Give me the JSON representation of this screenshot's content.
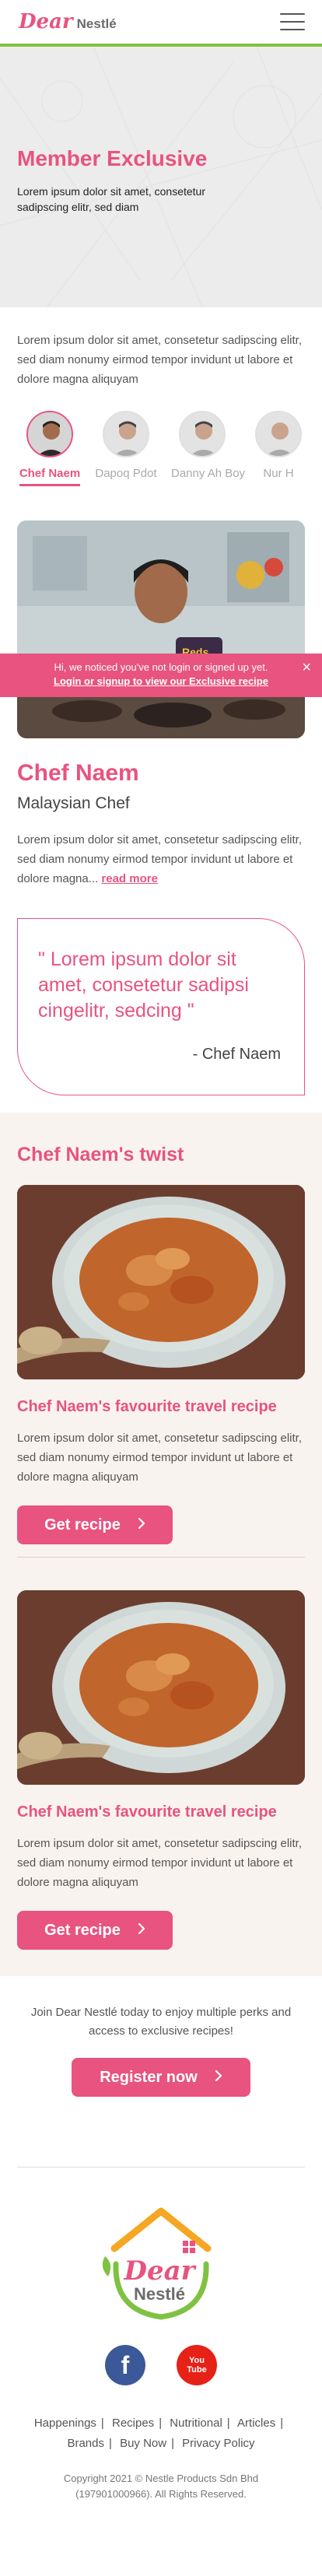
{
  "header": {
    "logo_dear": "Dear",
    "logo_nestle": "Nestlé",
    "menu_icon": "hamburger-menu-icon"
  },
  "hero": {
    "title": "Member Exclusive",
    "subtitle": "Lorem ipsum dolor sit amet, consetetur sadipscing elitr, sed diam"
  },
  "intro": "Lorem ipsum dolor sit amet, consetetur sadipscing elitr, sed diam nonumy eirmod tempor invidunt ut labore et dolore magna aliquyam",
  "chefs": [
    {
      "name": "Chef Naem",
      "active": true
    },
    {
      "name": "Dapoq Pdot",
      "active": false
    },
    {
      "name": "Danny Ah Boy",
      "active": false
    },
    {
      "name": "Nur H",
      "active": false
    }
  ],
  "login_banner": {
    "message": "Hi, we noticed you've not login or signed up yet.",
    "link": "Login or signup to view our Exclusive recipe",
    "close": "×"
  },
  "chef_profile": {
    "name": "Chef Naem",
    "origin": "Malaysian Chef",
    "bio": "Lorem ipsum dolor sit amet, consetetur sadipscing elitr, sed diam nonumy eirmod tempor invidunt ut labore et dolore magna...",
    "read_more": "read more",
    "quote": "\" Lorem ipsum dolor sit amet, consetetur sadipsi cingelitr, sedcing \"",
    "quote_author": "- Chef Naem"
  },
  "twist": {
    "title": "Chef Naem's twist",
    "recipes": [
      {
        "title": "Chef Naem's favourite travel recipe",
        "desc": "Lorem ipsum dolor sit amet, consetetur sadipscing elitr, sed diam nonumy eirmod tempor invidunt ut labore et dolore magna aliquyam",
        "button": "Get recipe"
      },
      {
        "title": "Chef Naem's favourite travel recipe",
        "desc": "Lorem ipsum dolor sit amet, consetetur sadipscing elitr, sed diam nonumy eirmod tempor invidunt ut labore et dolore magna aliquyam",
        "button": "Get recipe"
      }
    ]
  },
  "join": {
    "text": "Join Dear Nestlé today to enjoy multiple perks and access to exclusive recipes!",
    "button": "Register now"
  },
  "footer": {
    "logo_dear": "Dear",
    "logo_nestle": "Nestlé",
    "social": {
      "facebook": "f",
      "youtube_top": "You",
      "youtube_bottom": "Tube"
    },
    "links": [
      "Happenings",
      "Recipes",
      "Nutritional",
      "Articles",
      "Brands",
      "Buy Now",
      "Privacy Policy"
    ],
    "copyright_line1": "Copyright 2021 © Nestle Products Sdn Bhd",
    "copyright_line2": "(197901000966). All Rights Reserved."
  },
  "colors": {
    "accent": "#e8537f",
    "header_border": "#7fc242",
    "twist_bg": "#f9f3ef"
  }
}
